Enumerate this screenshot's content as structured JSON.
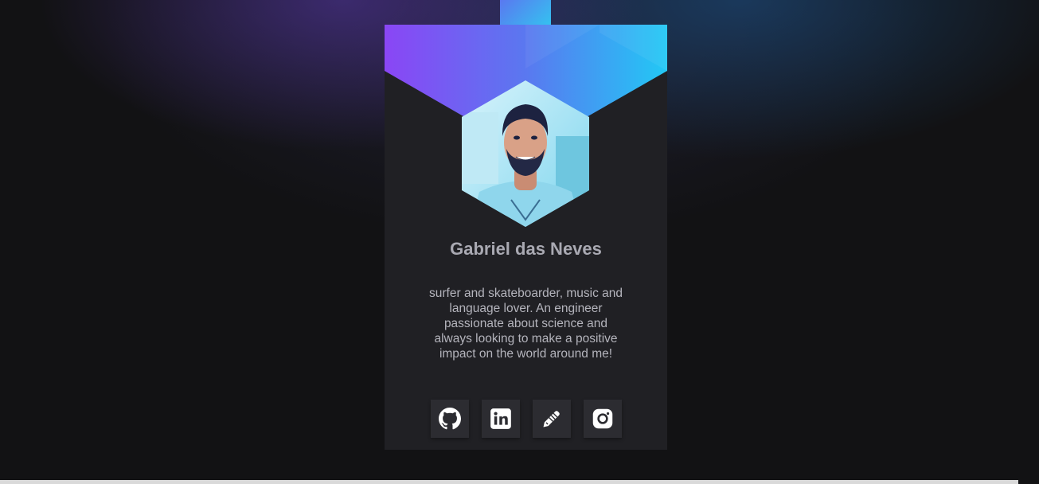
{
  "profile": {
    "name": "Gabriel das Neves",
    "bio": "surfer and skateboarder, music and language lover. An engineer passionate about science and always looking to make a positive impact on the world around me!"
  },
  "social_links": [
    {
      "icon": "github-icon"
    },
    {
      "icon": "linkedin-icon"
    },
    {
      "icon": "pencil-icon"
    },
    {
      "icon": "instagram-icon"
    }
  ],
  "colors": {
    "background": "#121214",
    "card": "#202024",
    "accent_purple": "#8a46f5",
    "accent_cyan": "#22c8f5",
    "button": "#2c2c31",
    "text": "#a9a9b2"
  }
}
